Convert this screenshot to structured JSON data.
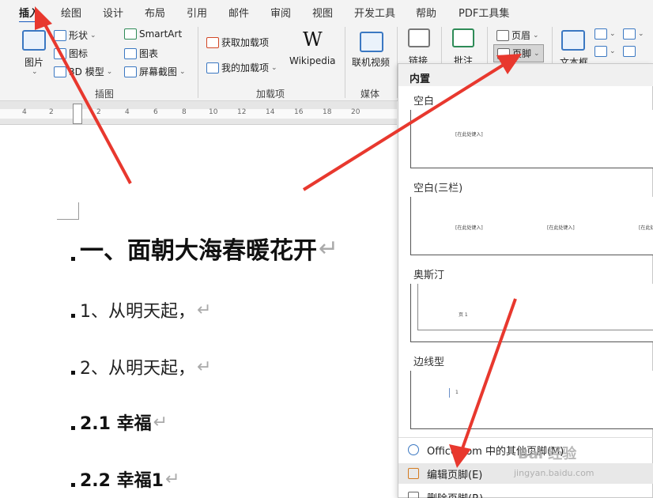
{
  "menu": {
    "tabs": [
      "插入",
      "绘图",
      "设计",
      "布局",
      "引用",
      "邮件",
      "审阅",
      "视图",
      "开发工具",
      "帮助",
      "PDF工具集"
    ],
    "active": "插入"
  },
  "ribbon": {
    "picture": "图片",
    "shapes": "形状",
    "icons": "图标",
    "model3d": "3D 模型",
    "smartart": "SmartArt",
    "chart": "图表",
    "screenshot": "屏幕截图",
    "group_illustrations": "插图",
    "get_addins": "获取加载项",
    "my_addins": "我的加载项",
    "wikipedia": "Wikipedia",
    "group_addins": "加载项",
    "online_video": "联机视频",
    "group_media": "媒体",
    "link": "链接",
    "comment": "批注",
    "header": "页眉",
    "footer": "页脚",
    "textbox": "文本框"
  },
  "ruler": {
    "numbers": [
      "4",
      "2",
      "2",
      "4",
      "6",
      "8",
      "10",
      "12",
      "14",
      "16",
      "18",
      "20"
    ]
  },
  "document": {
    "heading1": "一、面朝大海春暖花开",
    "p1": "1、从明天起，",
    "p2": "2、从明天起，",
    "h21": "2.1  幸福",
    "h22": "2.2  幸福1",
    "return_mark": "↵"
  },
  "footer_gallery": {
    "section_title": "内置",
    "styles": [
      {
        "name": "空白",
        "placeholders": [
          "[在此处键入]"
        ]
      },
      {
        "name": "空白(三栏)",
        "placeholders": [
          "[在此处键入]",
          "[在此处键入]",
          "[在此处键入]"
        ]
      },
      {
        "name": "奥斯汀",
        "placeholders": [
          "页 1"
        ]
      },
      {
        "name": "边线型",
        "placeholders": [
          "1"
        ]
      }
    ],
    "menu_items": [
      {
        "label": "Office.com 中的其他页脚(M)"
      },
      {
        "label": "编辑页脚(E)"
      },
      {
        "label": "删除页脚(R)"
      }
    ]
  },
  "watermark": {
    "text": "Bai 经验",
    "url": "jingyan.baidu.com"
  },
  "colors": {
    "accent": "#185abd",
    "arrow": "#e8382e"
  }
}
